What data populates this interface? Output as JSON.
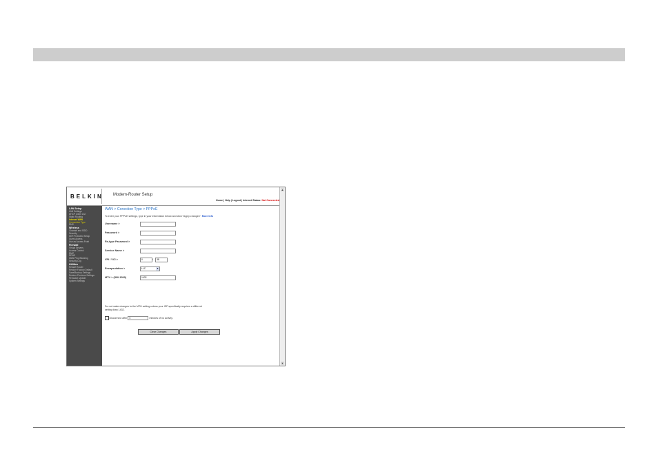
{
  "header": {
    "logo": "BELKIN",
    "title": "Modem-Router Setup",
    "links": [
      "Home",
      "Help",
      "Logout"
    ],
    "status_label": "Internet Status:",
    "status_value": "Not Connected"
  },
  "sidebar": {
    "sections": [
      {
        "title": "LAN Setup",
        "items": [
          "LAN Settings",
          "DHCP Client List",
          "Static Routing"
        ]
      },
      {
        "title": "Internet WAN",
        "items": [
          "Connection Type",
          "DNS"
        ]
      },
      {
        "title": "Wireless",
        "items": [
          "Channel and SSID",
          "Security",
          "WiFi Protected Setup",
          "Guest Access",
          "Use as Access Point"
        ]
      },
      {
        "title": "Firewall",
        "items": [
          "Virtual Servers",
          "Access Control",
          "DMZ",
          "DDNS",
          "WAN Ping Blocking",
          "Security Log"
        ]
      },
      {
        "title": "Utilities",
        "items": [
          "Restart Router",
          "Restore Factory Default",
          "Save/Backup Settings",
          "Restore Previous Settings",
          "Firmware Update",
          "System Settings"
        ]
      }
    ]
  },
  "main": {
    "breadcrumb": "WAN > Conection Type > PPPoE",
    "intro": "To enter your PPPoE settings, type in your information below and click \"Apply changes\".",
    "more_info": "More Info",
    "fields": {
      "username": {
        "label": "Username >",
        "value": ""
      },
      "password": {
        "label": "Password >",
        "value": ""
      },
      "retype": {
        "label": "Re-type Password >",
        "value": ""
      },
      "service": {
        "label": "Service Name >",
        "value": ""
      },
      "vpivci": {
        "label": "VPI / VCI >",
        "vpi": "0",
        "vci": "38"
      },
      "encapsulation": {
        "label": "Encapsulation >",
        "value": "LLC"
      },
      "mtu": {
        "label": "MTU > (500-1500)",
        "value": "1432"
      }
    },
    "note_line1": "Do not make changes to the MTU setting unless your ISP specifically requires a different",
    "note_line2": "setting than 1432.",
    "disconnect": {
      "prefix": "Disconnect after",
      "value": "5",
      "suffix": "minutes of no activity."
    },
    "buttons": {
      "clear": "Clear Changes",
      "apply": "Apply Changes"
    }
  }
}
